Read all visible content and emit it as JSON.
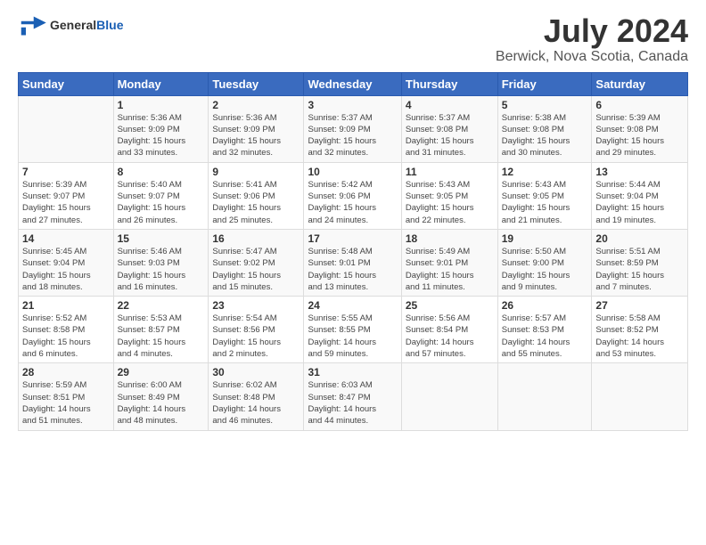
{
  "header": {
    "logo_line1": "General",
    "logo_line2": "Blue",
    "title": "July 2024",
    "subtitle": "Berwick, Nova Scotia, Canada"
  },
  "calendar": {
    "days_of_week": [
      "Sunday",
      "Monday",
      "Tuesday",
      "Wednesday",
      "Thursday",
      "Friday",
      "Saturday"
    ],
    "weeks": [
      [
        {
          "day": "",
          "info": ""
        },
        {
          "day": "1",
          "info": "Sunrise: 5:36 AM\nSunset: 9:09 PM\nDaylight: 15 hours\nand 33 minutes."
        },
        {
          "day": "2",
          "info": "Sunrise: 5:36 AM\nSunset: 9:09 PM\nDaylight: 15 hours\nand 32 minutes."
        },
        {
          "day": "3",
          "info": "Sunrise: 5:37 AM\nSunset: 9:09 PM\nDaylight: 15 hours\nand 32 minutes."
        },
        {
          "day": "4",
          "info": "Sunrise: 5:37 AM\nSunset: 9:08 PM\nDaylight: 15 hours\nand 31 minutes."
        },
        {
          "day": "5",
          "info": "Sunrise: 5:38 AM\nSunset: 9:08 PM\nDaylight: 15 hours\nand 30 minutes."
        },
        {
          "day": "6",
          "info": "Sunrise: 5:39 AM\nSunset: 9:08 PM\nDaylight: 15 hours\nand 29 minutes."
        }
      ],
      [
        {
          "day": "7",
          "info": "Sunrise: 5:39 AM\nSunset: 9:07 PM\nDaylight: 15 hours\nand 27 minutes."
        },
        {
          "day": "8",
          "info": "Sunrise: 5:40 AM\nSunset: 9:07 PM\nDaylight: 15 hours\nand 26 minutes."
        },
        {
          "day": "9",
          "info": "Sunrise: 5:41 AM\nSunset: 9:06 PM\nDaylight: 15 hours\nand 25 minutes."
        },
        {
          "day": "10",
          "info": "Sunrise: 5:42 AM\nSunset: 9:06 PM\nDaylight: 15 hours\nand 24 minutes."
        },
        {
          "day": "11",
          "info": "Sunrise: 5:43 AM\nSunset: 9:05 PM\nDaylight: 15 hours\nand 22 minutes."
        },
        {
          "day": "12",
          "info": "Sunrise: 5:43 AM\nSunset: 9:05 PM\nDaylight: 15 hours\nand 21 minutes."
        },
        {
          "day": "13",
          "info": "Sunrise: 5:44 AM\nSunset: 9:04 PM\nDaylight: 15 hours\nand 19 minutes."
        }
      ],
      [
        {
          "day": "14",
          "info": "Sunrise: 5:45 AM\nSunset: 9:04 PM\nDaylight: 15 hours\nand 18 minutes."
        },
        {
          "day": "15",
          "info": "Sunrise: 5:46 AM\nSunset: 9:03 PM\nDaylight: 15 hours\nand 16 minutes."
        },
        {
          "day": "16",
          "info": "Sunrise: 5:47 AM\nSunset: 9:02 PM\nDaylight: 15 hours\nand 15 minutes."
        },
        {
          "day": "17",
          "info": "Sunrise: 5:48 AM\nSunset: 9:01 PM\nDaylight: 15 hours\nand 13 minutes."
        },
        {
          "day": "18",
          "info": "Sunrise: 5:49 AM\nSunset: 9:01 PM\nDaylight: 15 hours\nand 11 minutes."
        },
        {
          "day": "19",
          "info": "Sunrise: 5:50 AM\nSunset: 9:00 PM\nDaylight: 15 hours\nand 9 minutes."
        },
        {
          "day": "20",
          "info": "Sunrise: 5:51 AM\nSunset: 8:59 PM\nDaylight: 15 hours\nand 7 minutes."
        }
      ],
      [
        {
          "day": "21",
          "info": "Sunrise: 5:52 AM\nSunset: 8:58 PM\nDaylight: 15 hours\nand 6 minutes."
        },
        {
          "day": "22",
          "info": "Sunrise: 5:53 AM\nSunset: 8:57 PM\nDaylight: 15 hours\nand 4 minutes."
        },
        {
          "day": "23",
          "info": "Sunrise: 5:54 AM\nSunset: 8:56 PM\nDaylight: 15 hours\nand 2 minutes."
        },
        {
          "day": "24",
          "info": "Sunrise: 5:55 AM\nSunset: 8:55 PM\nDaylight: 14 hours\nand 59 minutes."
        },
        {
          "day": "25",
          "info": "Sunrise: 5:56 AM\nSunset: 8:54 PM\nDaylight: 14 hours\nand 57 minutes."
        },
        {
          "day": "26",
          "info": "Sunrise: 5:57 AM\nSunset: 8:53 PM\nDaylight: 14 hours\nand 55 minutes."
        },
        {
          "day": "27",
          "info": "Sunrise: 5:58 AM\nSunset: 8:52 PM\nDaylight: 14 hours\nand 53 minutes."
        }
      ],
      [
        {
          "day": "28",
          "info": "Sunrise: 5:59 AM\nSunset: 8:51 PM\nDaylight: 14 hours\nand 51 minutes."
        },
        {
          "day": "29",
          "info": "Sunrise: 6:00 AM\nSunset: 8:49 PM\nDaylight: 14 hours\nand 48 minutes."
        },
        {
          "day": "30",
          "info": "Sunrise: 6:02 AM\nSunset: 8:48 PM\nDaylight: 14 hours\nand 46 minutes."
        },
        {
          "day": "31",
          "info": "Sunrise: 6:03 AM\nSunset: 8:47 PM\nDaylight: 14 hours\nand 44 minutes."
        },
        {
          "day": "",
          "info": ""
        },
        {
          "day": "",
          "info": ""
        },
        {
          "day": "",
          "info": ""
        }
      ]
    ]
  }
}
